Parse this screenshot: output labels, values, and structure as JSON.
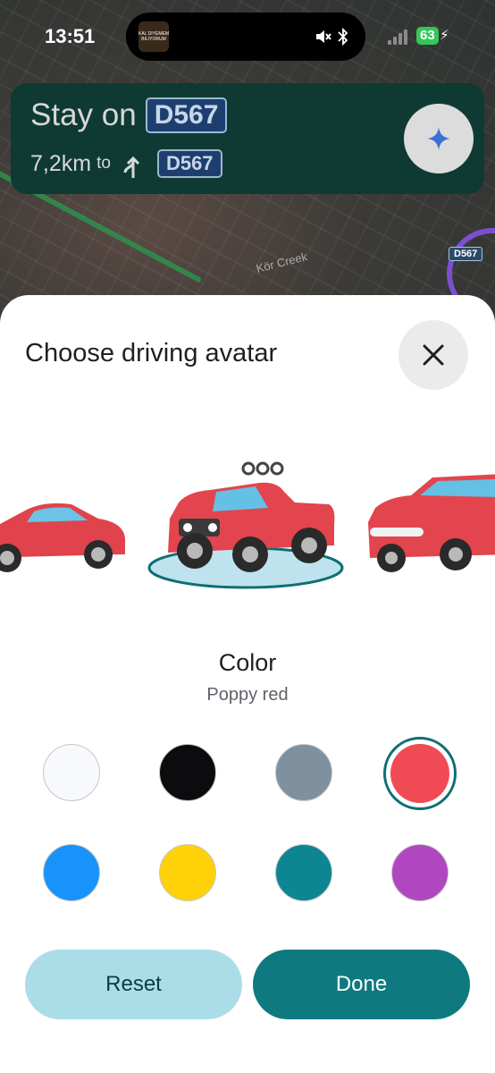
{
  "status_bar": {
    "time": "13:51",
    "battery": "63",
    "island_thumb_text": "KAL DIYEMEM BILIYORUM"
  },
  "map": {
    "place_label": "Kör Creek",
    "road_shield": "D567"
  },
  "navigation": {
    "instruction": "Stay on",
    "road": "D567",
    "distance": "7,2km",
    "to_label": "to",
    "next_road": "D567"
  },
  "sheet": {
    "title": "Choose driving avatar",
    "avatars": [
      {
        "name": "sedan",
        "selected": false
      },
      {
        "name": "offroad-truck",
        "selected": true
      },
      {
        "name": "suv",
        "selected": false
      }
    ],
    "color_heading": "Color",
    "selected_color_name": "Poppy red",
    "colors": [
      {
        "id": "white",
        "hex": "#f8f9fd",
        "selected": false
      },
      {
        "id": "black",
        "hex": "#0c0c0e",
        "selected": false
      },
      {
        "id": "gray",
        "hex": "#7f919f",
        "selected": false
      },
      {
        "id": "poppy-red",
        "hex": "#f04a55",
        "selected": true
      },
      {
        "id": "blue",
        "hex": "#1893fb",
        "selected": false
      },
      {
        "id": "yellow",
        "hex": "#fed109",
        "selected": false
      },
      {
        "id": "teal",
        "hex": "#0d8593",
        "selected": false
      },
      {
        "id": "purple",
        "hex": "#b047c1",
        "selected": false
      }
    ],
    "reset_label": "Reset",
    "done_label": "Done"
  },
  "colors": {
    "nav_card_bg": "#0e3a33",
    "accent": "#0e7a80",
    "reset_bg": "#abdde9"
  }
}
